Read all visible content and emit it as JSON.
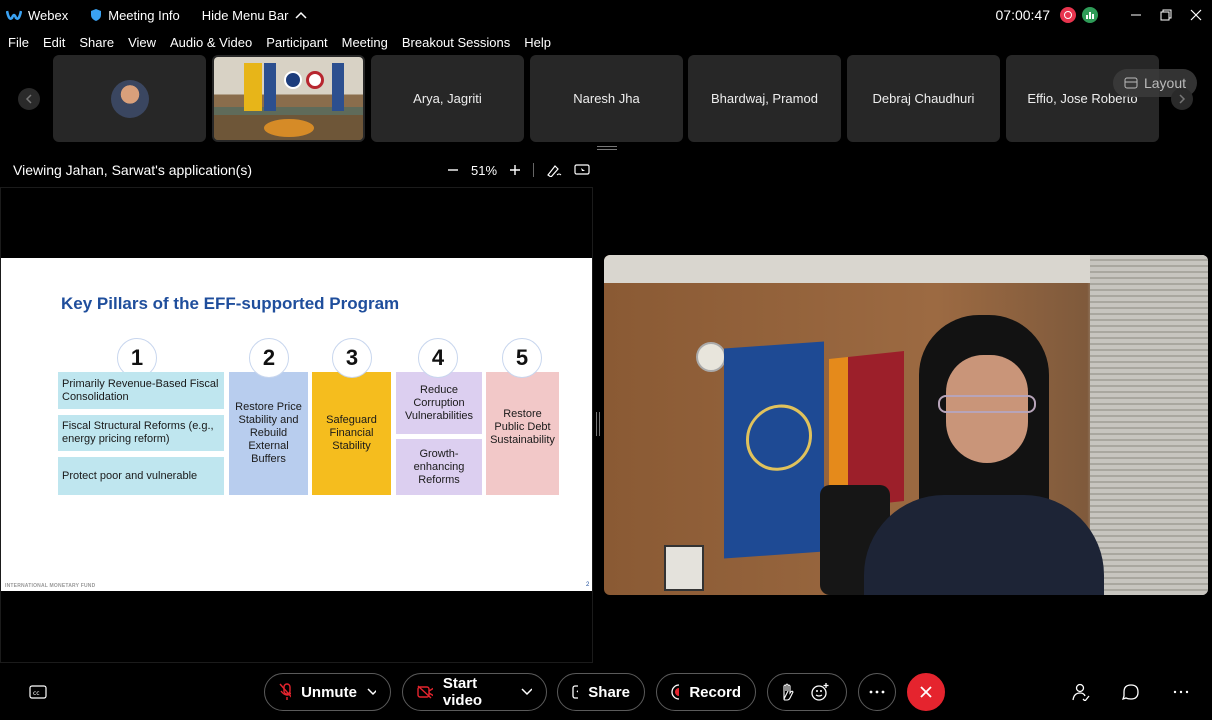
{
  "titlebar": {
    "app_name": "Webex",
    "meeting_info": "Meeting Info",
    "hide_menu": "Hide Menu Bar",
    "clock": "07:00:47"
  },
  "menu": [
    "File",
    "Edit",
    "Share",
    "View",
    "Audio & Video",
    "Participant",
    "Meeting",
    "Breakout Sessions",
    "Help"
  ],
  "participants": [
    "Arya, Jagriti",
    "Naresh Jha",
    "Bhardwaj, Pramod",
    "Debraj Chaudhuri",
    "Effio, Jose Roberto"
  ],
  "layout_label": "Layout",
  "share_bar": {
    "viewing": "Viewing Jahan, Sarwat's application(s)",
    "zoom": "51%"
  },
  "slide": {
    "title": "Key Pillars of the EFF-supported Program",
    "numbers": [
      "1",
      "2",
      "3",
      "4",
      "5"
    ],
    "col1": [
      "Primarily Revenue-Based Fiscal Consolidation",
      "Fiscal Structural Reforms (e.g., energy pricing reform)",
      "Protect poor and vulnerable"
    ],
    "col2": "Restore Price Stability and Rebuild External Buffers",
    "col3": "Safeguard Financial Stability",
    "col4": [
      "Reduce Corruption Vulnerabilities",
      "Growth-enhancing Reforms"
    ],
    "col5": "Restore Public Debt Sustainability",
    "footer": "INTERNATIONAL MONETARY FUND",
    "page": "2",
    "colors": {
      "cyan": "#bfe6ef",
      "blue": "#b8cdee",
      "yellow": "#f5bd1e",
      "purple": "#dccff0",
      "pink": "#f2c8c8"
    }
  },
  "toolbar": {
    "unmute": "Unmute",
    "start_video": "Start video",
    "share": "Share",
    "record": "Record"
  }
}
